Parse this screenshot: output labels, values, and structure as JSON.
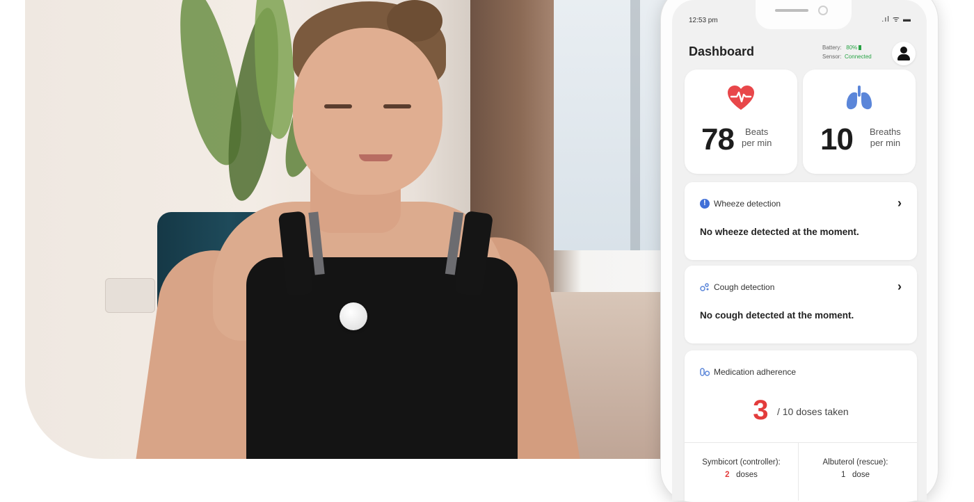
{
  "status_bar": {
    "time": "12:53 pm",
    "signal_wifi_battery": ".ıl ᯤ ▬"
  },
  "header": {
    "title": "Dashboard",
    "battery_label": "Battery:",
    "battery_value": "80%",
    "sensor_label": "Sensor:",
    "sensor_value": "Connected"
  },
  "vitals": {
    "heart": {
      "value": "78",
      "unit_line1": "Beats",
      "unit_line2": "per min",
      "icon": "heart-rate-icon"
    },
    "breath": {
      "value": "10",
      "unit_line1": "Breaths",
      "unit_line2": "per min",
      "icon": "lungs-icon"
    }
  },
  "wheeze": {
    "title": "Wheeze detection",
    "message": "No wheeze detected at the moment."
  },
  "cough": {
    "title": "Cough detection",
    "message": "No cough detected at the moment."
  },
  "medication": {
    "title": "Medication adherence",
    "taken": "3",
    "total_text": "/ 10 doses taken",
    "controller_label": "Symbicort (controller):",
    "controller_doses": "2",
    "controller_unit": "doses",
    "rescue_label": "Albuterol (rescue):",
    "rescue_doses": "1",
    "rescue_unit": "dose"
  },
  "colors": {
    "heart": "#e8474a",
    "lungs": "#5b86d9",
    "ok": "#27a244",
    "alert": "#e33c3c",
    "info": "#3f6fd8"
  }
}
